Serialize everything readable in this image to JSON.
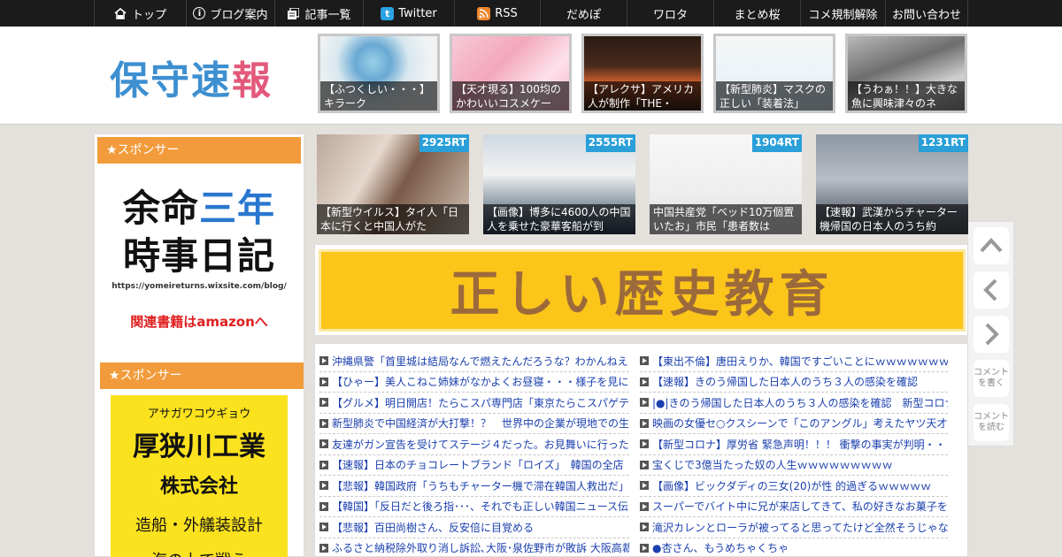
{
  "nav": [
    {
      "label": "トップ",
      "icon": "home-icon"
    },
    {
      "label": "ブログ案内",
      "icon": "info-icon"
    },
    {
      "label": "記事一覧",
      "icon": "list-icon"
    },
    {
      "label": "Twitter",
      "icon": "twitter-icon"
    },
    {
      "label": "RSS",
      "icon": "rss-icon"
    },
    {
      "label": "だめぽ"
    },
    {
      "label": "ワロタ"
    },
    {
      "label": "まとめ桜"
    },
    {
      "label": "コメ規制解除"
    },
    {
      "label": "お問い合わせ"
    }
  ],
  "logo": {
    "part1": "保守",
    "part2": "速",
    "part3": "報"
  },
  "header_thumbs": [
    {
      "caption": "【ふつくしい・・・】キラーク"
    },
    {
      "caption": "【天才現る】100均のかわいいコスメケー"
    },
    {
      "caption": "【アレクサ】アメリカ人が制作「THE・"
    },
    {
      "caption": "【新型肺炎】マスクの正しい「装着法」"
    },
    {
      "caption": "【うわぁ！！】大きな魚に興味津々のネ"
    }
  ],
  "sidebar": {
    "sponsor_label_1": "★スポンサー",
    "sponsor_label_2": "★スポンサー",
    "ad1": {
      "line1_a": "余命",
      "line1_b": "三年",
      "line2": "時事日記",
      "url": "https://yomeireturns.wixsite.com/blog/",
      "cta": "関連書籍はamazonへ"
    },
    "ad2": {
      "kana": "アサガワコウギョウ",
      "name": "厚狭川工業",
      "corp": "株式会社",
      "service": "造船・外艤装設計",
      "tagline": "海の上で戦う"
    }
  },
  "featured": [
    {
      "rt": "2925RT",
      "caption": "【新型ウイルス】タイ人「日本に行くと中国人がた"
    },
    {
      "rt": "2555RT",
      "caption": "【画像】博多に4600人の中国人を乗せた豪華客船が到"
    },
    {
      "rt": "1904RT",
      "caption": "中国共産党「ベッド10万個置いたお」市民「患者数は"
    },
    {
      "rt": "1231RT",
      "caption": "【速報】武漢からチャーター機帰国の日本人のうち約"
    }
  ],
  "banner_text": "正しい歴史教育",
  "articles_left": [
    "沖縄県警「首里城は結局なんで燃えたんだろうな？わかんねえ",
    "【ひゃー】美人こねこ姉妹がなかよくお昼寝・・・様子を見に",
    "【グルメ】明日開店！たらこスパ専門店「東京たらこスパゲテ",
    "新型肺炎で中国経済が大打撃！？　世界中の企業が現地での生",
    "友達がガン宣告を受けてステージ４だった。お見舞いに行った",
    "【速報】日本のチョコレートブランド「ロイズ」　韓国の全店",
    "【悲報】韓国政府「うちもチャーター機で滞在韓国人救出だ」",
    "【韓国】「反日だと後ろ指･･･、それでも正しい韓国ニュース伝",
    "【悲報】百田尚樹さん、反安倍に目覚める",
    "ふるさと納税除外取り消し訴訟､大阪･泉佐野市が敗訴 大阪高裁"
  ],
  "articles_right": [
    "【東出不倫】唐田えりか、韓国ですごいことにｗｗｗｗｗｗｗ",
    "【速報】きのう帰国した日本人のうち３人の感染を確認",
    "|●|きのう帰国した日本人のうち３人の感染を確認　新型コロナ",
    "映画の女優セ○クスシーンで「このアングル」考えたヤツ天才だ",
    "【新型コロナ】厚労省 緊急声明！！！ 衝撃の事実が判明・・",
    "宝くじで3億当たった奴の人生ｗｗｗｗｗｗｗｗｗ",
    "【画像】ビックダディの三女(20)が性 的過ぎるｗｗｗｗｗ",
    "スーパーでバイト中に兄が来店してきて、私の好きなお菓子を",
    "滝沢カレンとローラが被ってると思ってたけど全然そうじゃな",
    "●杏さん、もうめちゃくちゃ"
  ],
  "side_buttons": {
    "write_comment": "コメントを書く",
    "read_comment": "コメントを読む"
  },
  "colors": {
    "nav_bg": "#1b1b1b",
    "sponsor_header": "#f29b3c",
    "rt_badge": "#2a9fd8",
    "link": "#1a3fae",
    "banner_bg": "#fcc51a"
  }
}
